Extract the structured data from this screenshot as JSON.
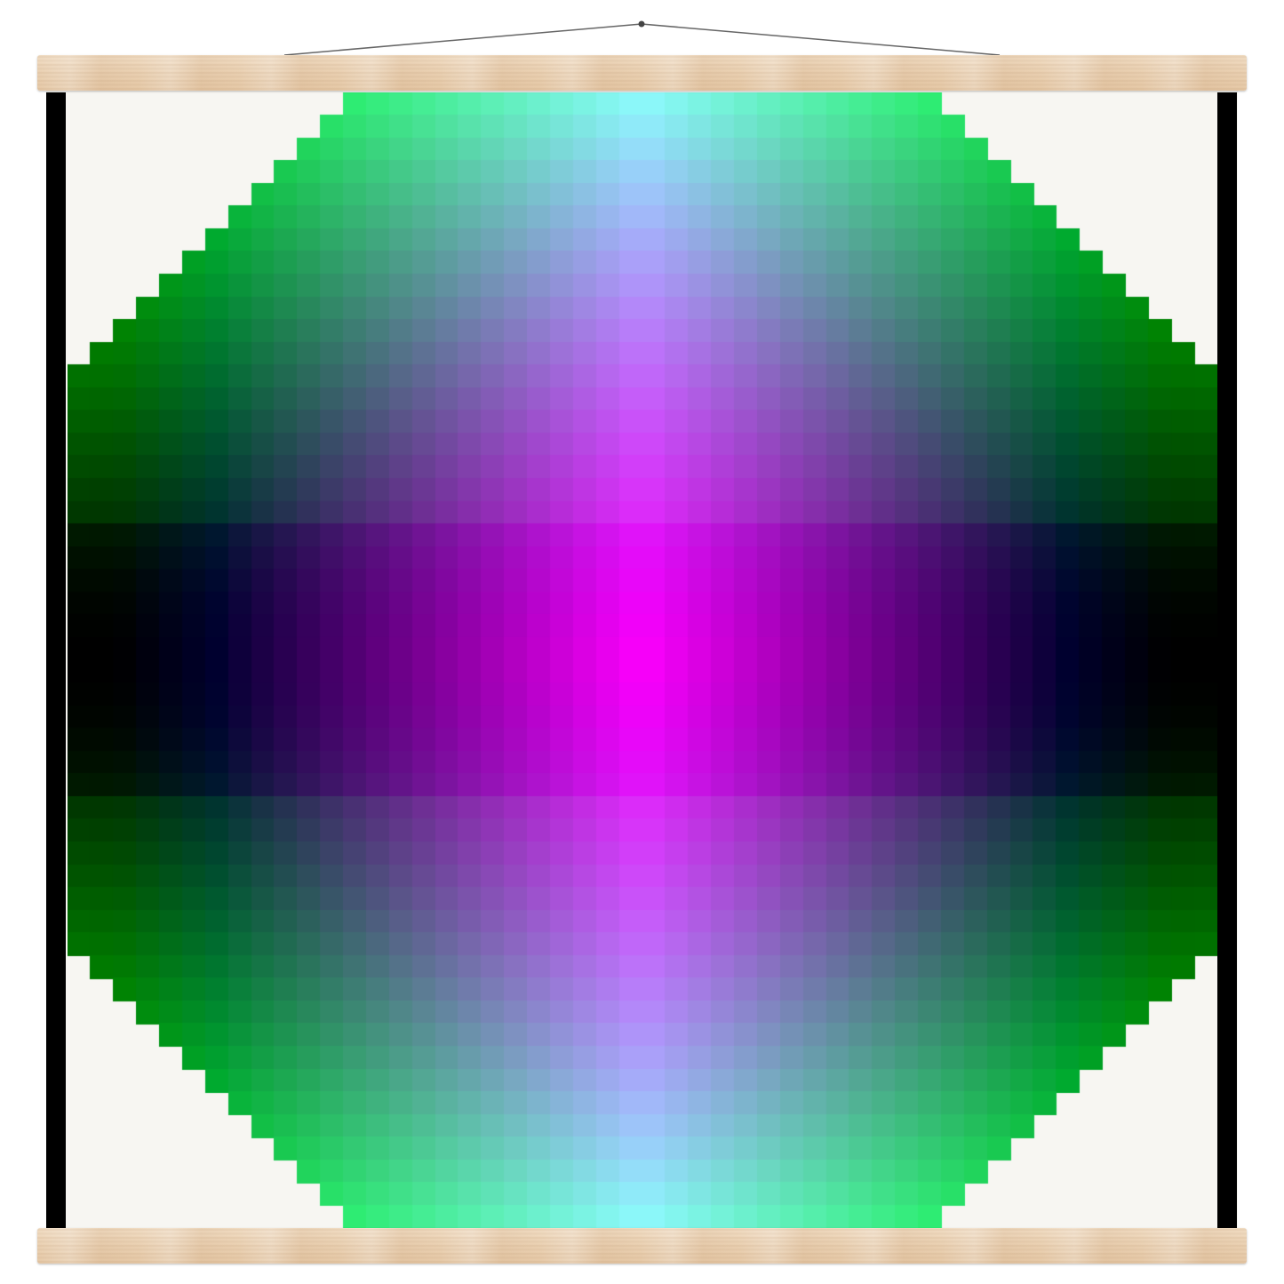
{
  "artwork": {
    "kind": "pixel-gradient-octagon",
    "grid_columns": 50,
    "grid_rows": 50,
    "corner_step_cells": 12,
    "colors": {
      "edge_corner": "#00ff66",
      "top_bottom_center": "#00ffff",
      "center": "#ff00ff",
      "left_right_middle": "#000000",
      "side_green": "#008000",
      "paper": "#f7f6f2",
      "side_bar": "#000000",
      "wood": "#ecd3b5",
      "string": "#555555"
    }
  },
  "hanger": {
    "top_rail": "wood-rail",
    "bottom_rail": "wood-rail",
    "string": "hanging-string",
    "nail": "nail-dot"
  }
}
